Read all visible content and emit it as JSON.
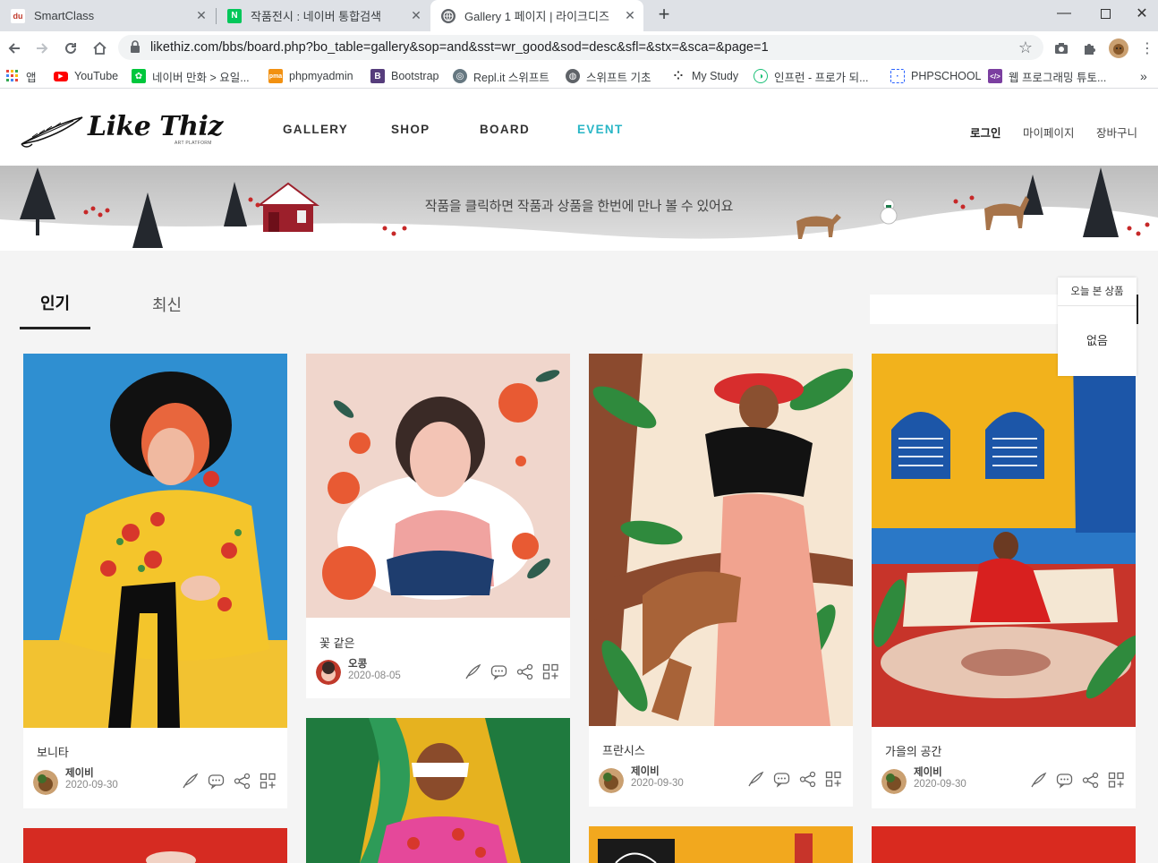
{
  "browser": {
    "tabs": [
      {
        "title": "SmartClass",
        "icon": "smartclass-favicon"
      },
      {
        "title": "작품전시 : 네이버 통합검색",
        "icon": "naver-favicon"
      },
      {
        "title": "Gallery 1 페이지 | 라이크디즈",
        "icon": "globe-favicon",
        "active": true
      }
    ],
    "url": "likethiz.com/bbs/board.php?bo_table=gallery&sop=and&sst=wr_good&sod=desc&sfl=&stx=&sca=&page=1",
    "bookmarks": [
      {
        "label": "앱",
        "icon": "apps-icon"
      },
      {
        "label": "YouTube",
        "icon": "youtube-icon"
      },
      {
        "label": "네이버 만화 > 요일...",
        "icon": "naver-webtoon-icon"
      },
      {
        "label": "phpmyadmin",
        "icon": "phpmyadmin-icon"
      },
      {
        "label": "Bootstrap",
        "icon": "bootstrap-icon"
      },
      {
        "label": "Repl.it 스위프트",
        "icon": "replit-icon"
      },
      {
        "label": "스위프트 기초",
        "icon": "globe-icon"
      },
      {
        "label": "My Study",
        "icon": "dots-icon"
      },
      {
        "label": "인프런 - 프로가 되...",
        "icon": "inflearn-icon"
      },
      {
        "label": "PHPSCHOOL",
        "icon": "phpschool-icon"
      },
      {
        "label": "웹 프로그래밍 튜토...",
        "icon": "code-icon"
      }
    ]
  },
  "site": {
    "logo_text": "Like Thiz",
    "logo_sub": "ART PLATFORM",
    "nav": [
      "GALLERY",
      "SHOP",
      "BOARD",
      "EVENT"
    ],
    "util": [
      "로그인",
      "마이페이지",
      "장바구니"
    ],
    "banner_text": "작품을 클릭하면 작품과 상품을 한번에 만나 볼 수 있어요"
  },
  "gallery": {
    "tabs": [
      "인기",
      "최신"
    ],
    "today_panel": {
      "title": "오늘 본 상품",
      "empty": "없음"
    },
    "cards": [
      {
        "title": "보니타",
        "author": "제이비",
        "date": "2020-09-30"
      },
      {
        "title": "꽃 같은",
        "author": "오콩",
        "date": "2020-08-05"
      },
      {
        "title": "프란시스",
        "author": "제이비",
        "date": "2020-09-30"
      },
      {
        "title": "가을의 공간",
        "author": "제이비",
        "date": "2020-09-30"
      }
    ]
  },
  "colors": {
    "accent": "#29b6c6",
    "background": "#f4f4f4"
  }
}
